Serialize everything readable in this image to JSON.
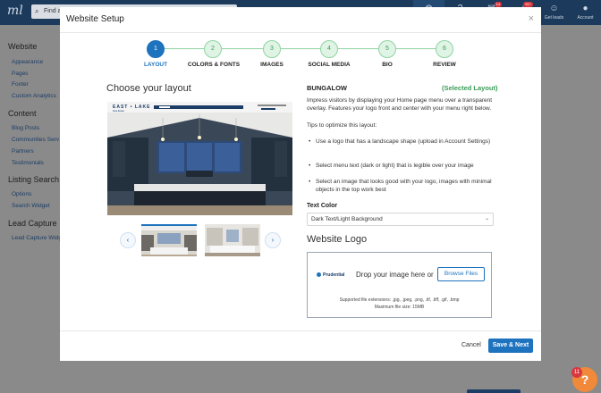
{
  "app": {
    "logo": "ml",
    "search_placeholder": "Find a",
    "topbar_items": [
      {
        "icon": "globe-icon",
        "label": "",
        "badge": ""
      },
      {
        "icon": "help-circle-icon",
        "label": "",
        "badge": ""
      },
      {
        "icon": "mail-icon",
        "label": "",
        "badge": "14"
      },
      {
        "icon": "bell-icon",
        "label": "",
        "badge": "91+"
      },
      {
        "icon": "users-icon",
        "label": "Get leads",
        "badge": ""
      },
      {
        "icon": "account-icon",
        "label": "Account",
        "badge": ""
      }
    ],
    "sidebar": {
      "sections": [
        {
          "heading": "Website",
          "items": [
            "Appearance",
            "Pages",
            "Footer",
            "Custom Analytics"
          ]
        },
        {
          "heading": "Content",
          "items": [
            "Blog Posts",
            "Communities Serv",
            "Partners",
            "Testimonials"
          ]
        },
        {
          "heading": "Listing Search",
          "items": [
            "Options",
            "Search Widget"
          ]
        },
        {
          "heading": "Lead Capture",
          "items": [
            "Lead Capture Widg"
          ]
        }
      ]
    }
  },
  "modal": {
    "title": "Website Setup",
    "close_glyph": "×",
    "steps": [
      {
        "number": "1",
        "label": "LAYOUT",
        "active": true
      },
      {
        "number": "2",
        "label": "COLORS & FONTS",
        "active": false
      },
      {
        "number": "3",
        "label": "IMAGES",
        "active": false
      },
      {
        "number": "4",
        "label": "SOCIAL MEDIA",
        "active": false
      },
      {
        "number": "5",
        "label": "BIO",
        "active": false
      },
      {
        "number": "6",
        "label": "REVIEW",
        "active": false
      }
    ],
    "choose_heading": "Choose your layout",
    "preview": {
      "brand_line1": "EAST • LAKE",
      "brand_line2": "Real Estate"
    },
    "carousel": {
      "prev_glyph": "‹",
      "next_glyph": "›"
    },
    "layout_name": "BUNGALOW",
    "selected_label": "(Selected Layout)",
    "description": "Impress visitors by displaying your Home page menu over a transparent overlay. Features your logo front and center with your menu right below.",
    "tips_heading": "Tips to optimize this layout:",
    "tips": [
      "Use a logo that has a landscape shape (upload in Account Settings)",
      "Select menu text (dark or light) that is legible over your image",
      "Select an image that looks good with your logo, images with minimal objects in the top work best"
    ],
    "text_color": {
      "label": "Text Color",
      "value": "Dark Text/Light Background"
    },
    "website_logo": {
      "heading": "Website Logo",
      "logo_text": "Prudential",
      "drop_text": "Drop your image here or",
      "browse_label": "Browse Files",
      "supported": "Supported file extensions: .jpg, .jpeg, .png, .tif, .tiff, .gif, .bmp",
      "max_size": "Maximum file size: 15MB"
    },
    "cancel_label": "Cancel",
    "save_label": "Save & Next"
  },
  "help": {
    "glyph": "?",
    "badge": "11"
  },
  "colors": {
    "accent": "#1e73be",
    "success": "#3a9c57",
    "topbar": "#1b3a5c",
    "help": "#f0893a"
  }
}
